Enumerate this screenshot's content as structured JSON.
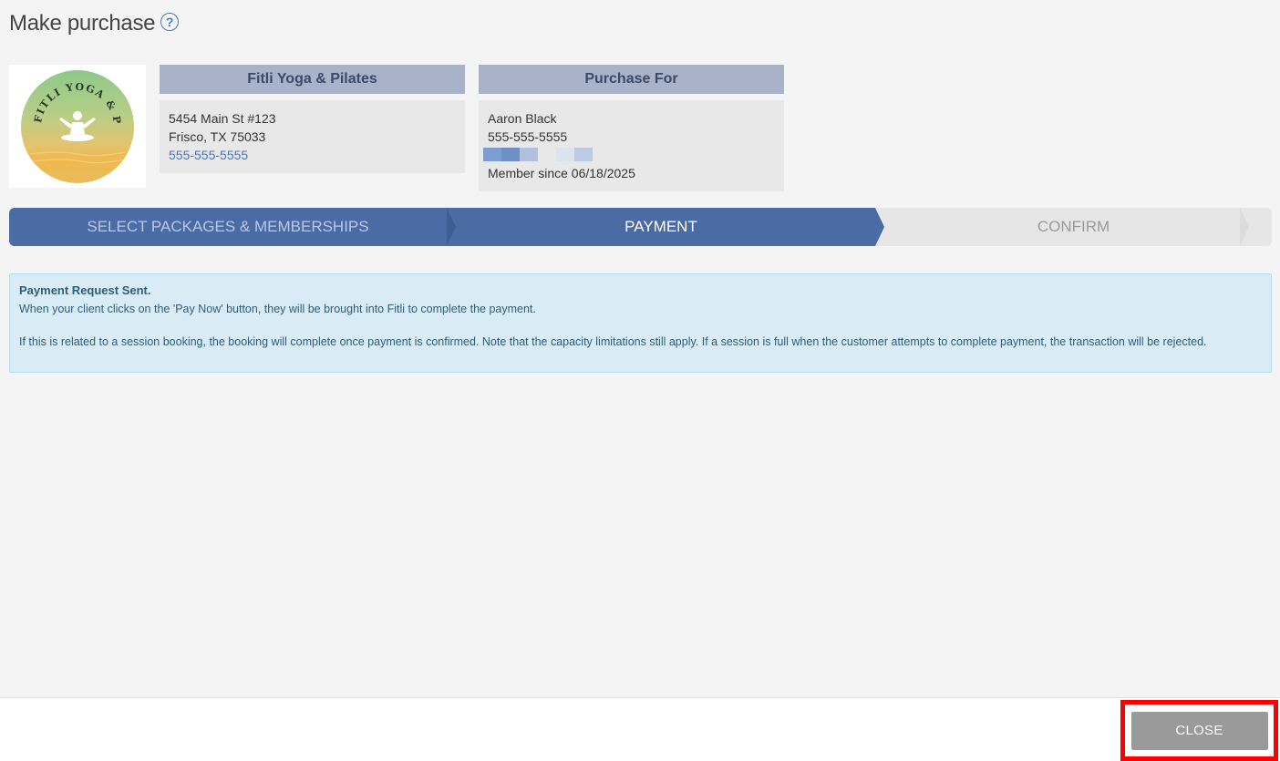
{
  "page": {
    "title": "Make purchase",
    "help_glyph": "?"
  },
  "studio": {
    "logo_text": "FITLI YOGA & PILATES",
    "header": "Fitli Yoga & Pilates",
    "address_line1": "5454 Main St #123",
    "address_line2": "Frisco, TX 75033",
    "phone": "555-555-5555"
  },
  "purchase_for": {
    "header": "Purchase For",
    "name": "Aaron Black",
    "phone": "555-555-5555",
    "member_since": "Member since 06/18/2025"
  },
  "steps": [
    {
      "label": "SELECT PACKAGES & MEMBERSHIPS",
      "state": "completed"
    },
    {
      "label": "PAYMENT",
      "state": "active"
    },
    {
      "label": "CONFIRM",
      "state": "upcoming"
    }
  ],
  "alert": {
    "title": "Payment Request Sent.",
    "line1": "When your client clicks on the 'Pay Now' button, they will be brought into Fitli to complete the payment.",
    "line2": "If this is related to a session booking, the booking will complete once payment is confirmed.  Note that the capacity limitations still apply. If a session is full when the customer attempts  to complete payment, the transaction will be rejected."
  },
  "footer": {
    "close_label": "CLOSE"
  },
  "colors": {
    "accent": "#4a6ba3",
    "card_header": "#a8b2c8",
    "alert_bg": "#d9ebf4",
    "highlight": "#ff0000"
  }
}
